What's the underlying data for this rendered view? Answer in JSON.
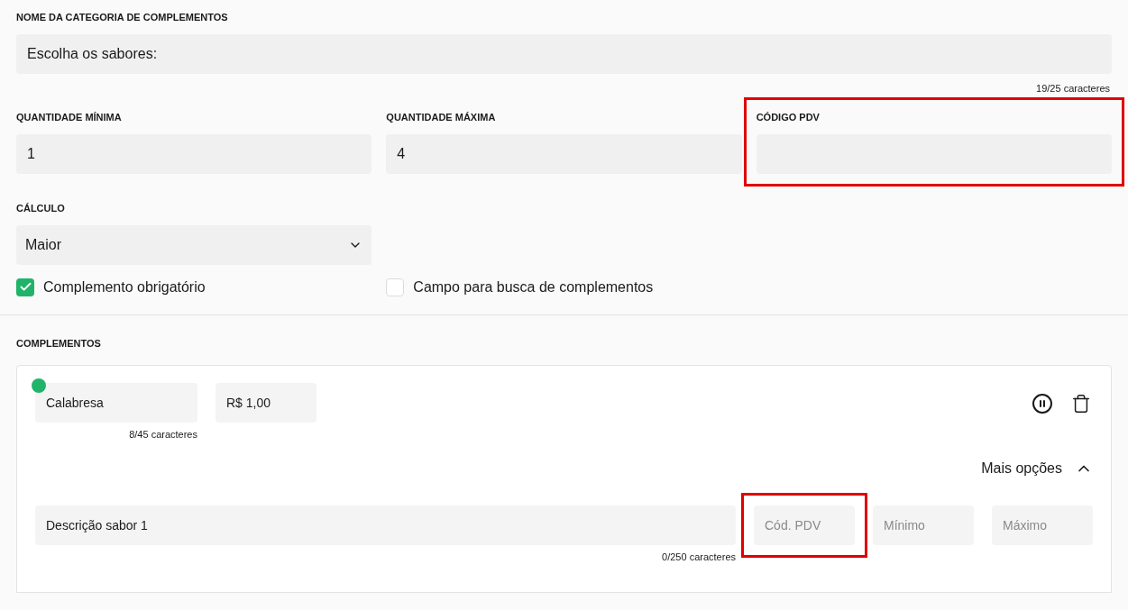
{
  "category_name": {
    "label": "NOME DA CATEGORIA DE COMPLEMENTOS",
    "value": "Escolha os sabores:",
    "counter": "19/25 caracteres"
  },
  "quantity_fields": [
    {
      "label": "QUANTIDADE MÍNIMA",
      "value": "1",
      "highlighted": false
    },
    {
      "label": "QUANTIDADE MÁXIMA",
      "value": "4",
      "highlighted": false
    },
    {
      "label": "CÓDIGO PDV",
      "highlighted": true
    }
  ],
  "calculation": {
    "label": "CÁLCULO",
    "value": "Maior"
  },
  "options": [
    {
      "label": "Complemento obrigatório",
      "checked": true
    },
    {
      "label": "Campo para busca de complementos",
      "checked": false
    }
  ],
  "complements": {
    "title": "COMPLEMENTOS",
    "items": [
      {
        "active": true,
        "name": "Calabresa",
        "name_counter": "8/45 caracteres",
        "price": "R$ 1,00",
        "more_label": "Mais opções",
        "expanded": true,
        "description": "Descrição sabor 1",
        "description_counter": "0/250 caracteres",
        "extra_fields": [
          {
            "placeholder": "Cód. PDV",
            "highlighted": true
          },
          {
            "placeholder": "Mínimo",
            "highlighted": false
          },
          {
            "placeholder": "Máximo",
            "highlighted": false
          }
        ]
      }
    ]
  }
}
